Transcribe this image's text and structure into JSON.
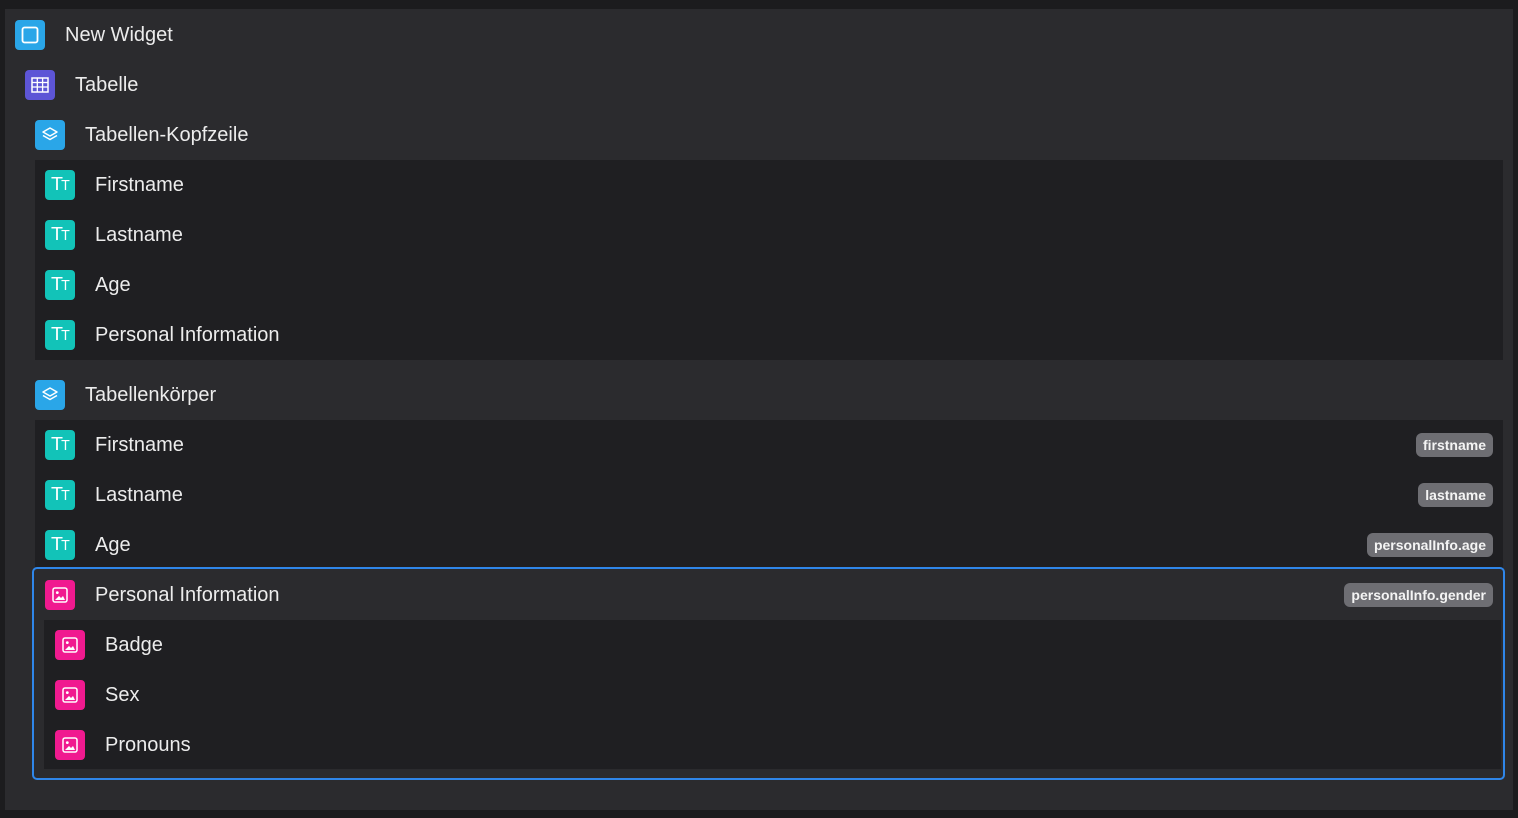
{
  "tree": {
    "root": {
      "label": "New Widget",
      "icon": "widget-icon"
    },
    "table": {
      "label": "Tabelle",
      "icon": "table-icon"
    },
    "header_group": {
      "label": "Tabellen-Kopfzeile",
      "icon": "layers-icon",
      "items": [
        {
          "label": "Firstname",
          "icon": "text-icon"
        },
        {
          "label": "Lastname",
          "icon": "text-icon"
        },
        {
          "label": "Age",
          "icon": "text-icon"
        },
        {
          "label": "Personal Information",
          "icon": "text-icon"
        }
      ]
    },
    "body_group": {
      "label": "Tabellenkörper",
      "icon": "layers-icon",
      "items": [
        {
          "label": "Firstname",
          "icon": "text-icon",
          "binding": "firstname"
        },
        {
          "label": "Lastname",
          "icon": "text-icon",
          "binding": "lastname"
        },
        {
          "label": "Age",
          "icon": "text-icon",
          "binding": "personalInfo.age"
        },
        {
          "label": "Personal Information",
          "icon": "image-icon",
          "binding": "personalInfo.gender",
          "selected": true,
          "children": [
            {
              "label": "Badge",
              "icon": "image-icon"
            },
            {
              "label": "Sex",
              "icon": "image-icon"
            },
            {
              "label": "Pronouns",
              "icon": "image-icon"
            }
          ]
        }
      ]
    }
  },
  "colors": {
    "background": "#1c1c1e",
    "panel": "#2b2b2e",
    "nested": "#1f1f22",
    "widget_icon": "#2aa6e8",
    "table_icon": "#5d55d6",
    "text_icon": "#12c3b8",
    "image_icon": "#f01a8f",
    "selection": "#2f86e9",
    "badge": "#6e6e73"
  }
}
